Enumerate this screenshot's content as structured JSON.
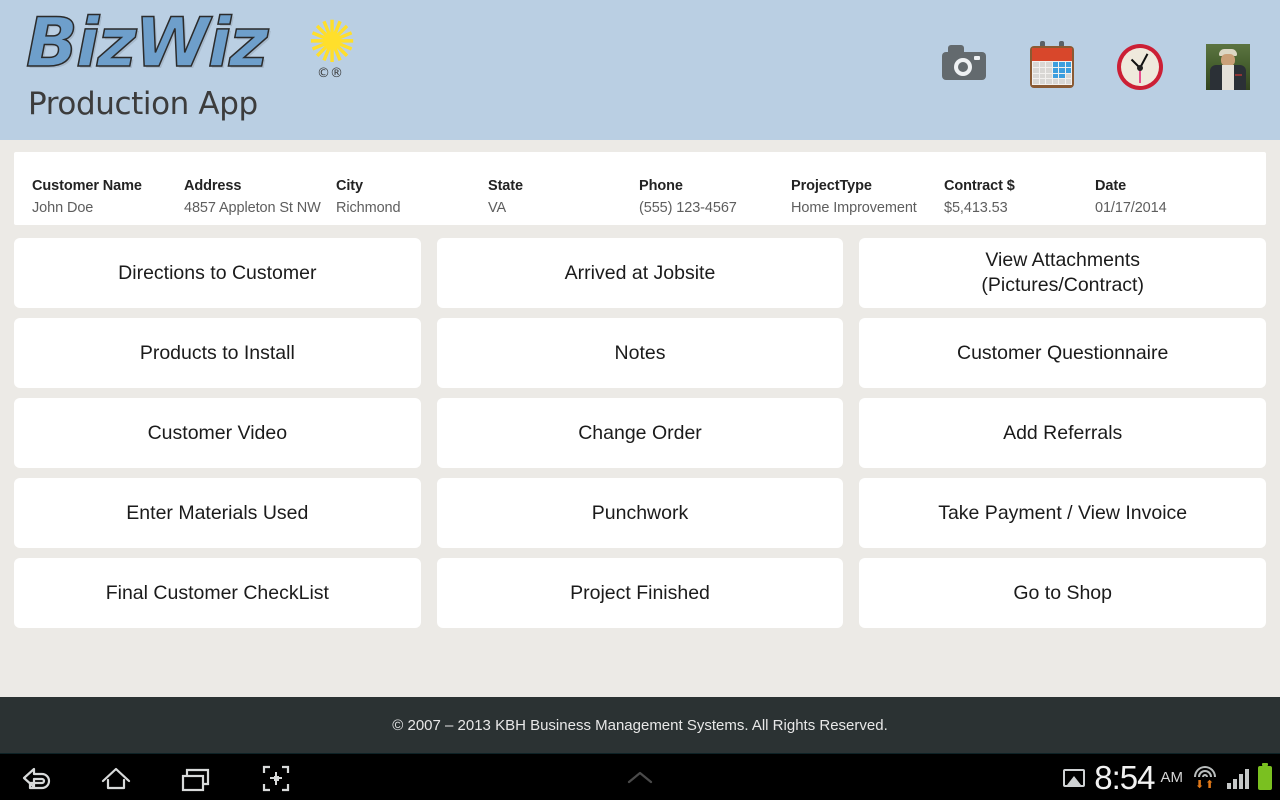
{
  "header": {
    "logo_main": "BizWiz",
    "logo_registered": "©®",
    "logo_sub": "Production App",
    "star_icon": "star-icon",
    "icons": [
      {
        "name": "camera-icon",
        "label": "Camera"
      },
      {
        "name": "calendar-icon",
        "label": "Calendar"
      },
      {
        "name": "clock-icon",
        "label": "Clock"
      },
      {
        "name": "user-avatar",
        "label": "User Profile"
      }
    ],
    "bg_color": "#bacfe3"
  },
  "info_card": {
    "fields": [
      {
        "label": "Customer Name",
        "value": "John Doe"
      },
      {
        "label": "Address",
        "value": "4857 Appleton St NW"
      },
      {
        "label": "City",
        "value": "Richmond"
      },
      {
        "label": "State",
        "value": "VA"
      },
      {
        "label": "Phone",
        "value": "(555) 123-4567"
      },
      {
        "label": "ProjectType",
        "value": "Home Improvement"
      },
      {
        "label": "Contract $",
        "value": "$5,413.53"
      },
      {
        "label": "Date",
        "value": "01/17/2014"
      }
    ]
  },
  "grid": {
    "rows": [
      [
        {
          "line1": "Directions to Customer",
          "line2": ""
        },
        {
          "line1": "Arrived at Jobsite",
          "line2": ""
        },
        {
          "line1": "View Attachments",
          "line2": "(Pictures/Contract)"
        }
      ],
      [
        {
          "line1": "Products to Install",
          "line2": ""
        },
        {
          "line1": "Notes",
          "line2": ""
        },
        {
          "line1": "Customer Questionnaire",
          "line2": ""
        }
      ],
      [
        {
          "line1": "Customer Video",
          "line2": ""
        },
        {
          "line1": "Change Order",
          "line2": ""
        },
        {
          "line1": "Add Referrals",
          "line2": ""
        }
      ],
      [
        {
          "line1": "Enter Materials Used",
          "line2": ""
        },
        {
          "line1": "Punchwork",
          "line2": ""
        },
        {
          "line1": "Take Payment / View Invoice",
          "line2": ""
        }
      ],
      [
        {
          "line1": "Final Customer CheckList",
          "line2": ""
        },
        {
          "line1": "Project Finished",
          "line2": ""
        },
        {
          "line1": "Go to Shop",
          "line2": ""
        }
      ]
    ]
  },
  "footer": {
    "copyright": "© 2007 – 2013 KBH Business Management Systems. All Rights Reserved.",
    "bg_color": "#2b3233"
  },
  "navbar": {
    "buttons": [
      {
        "name": "back-icon",
        "label": "Back"
      },
      {
        "name": "home-icon",
        "label": "Home"
      },
      {
        "name": "recent-apps-icon",
        "label": "Recent Apps"
      },
      {
        "name": "screenshot-icon",
        "label": "Screenshot"
      }
    ],
    "expand_icon": "chevron-up-icon",
    "status": {
      "image_icon": "image-icon",
      "time": "8:54",
      "ampm": "AM",
      "wifi_icon": "wifi-icon",
      "signal_icon": "signal-icon",
      "battery_icon": "battery-icon"
    }
  }
}
